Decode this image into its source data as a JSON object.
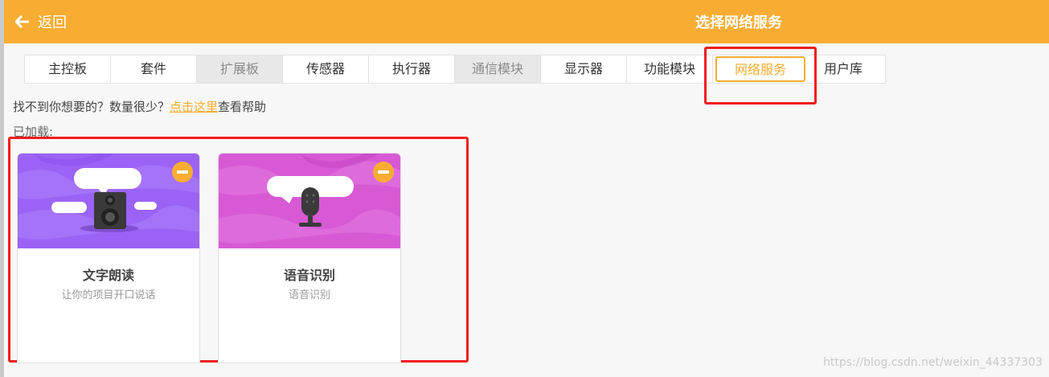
{
  "header": {
    "back_label": "返回",
    "title": "选择网络服务",
    "bg_color": "#f8ad32"
  },
  "tabs": [
    {
      "label": "主控板",
      "state": "normal"
    },
    {
      "label": "套件",
      "state": "normal"
    },
    {
      "label": "扩展板",
      "state": "disabled"
    },
    {
      "label": "传感器",
      "state": "normal"
    },
    {
      "label": "执行器",
      "state": "normal"
    },
    {
      "label": "通信模块",
      "state": "disabled"
    },
    {
      "label": "显示器",
      "state": "normal"
    },
    {
      "label": "功能模块",
      "state": "normal"
    },
    {
      "label": "网络服务",
      "state": "active"
    },
    {
      "label": "用户库",
      "state": "normal"
    }
  ],
  "help": {
    "prefix": "找不到你想要的？数量很少？",
    "link": "点击这里",
    "suffix": "查看帮助"
  },
  "loaded_label": "已加载:",
  "cards": [
    {
      "title": "文字朗读",
      "desc": "让你的项目开口说话",
      "icon": "speaker-icon",
      "color": "#9b63f5"
    },
    {
      "title": "语音识别",
      "desc": "语音识别",
      "icon": "microphone-icon",
      "color": "#d75ad4"
    }
  ],
  "watermark": "https://blog.csdn.net/weixin_44337303",
  "highlight_color": "#f21c1c"
}
